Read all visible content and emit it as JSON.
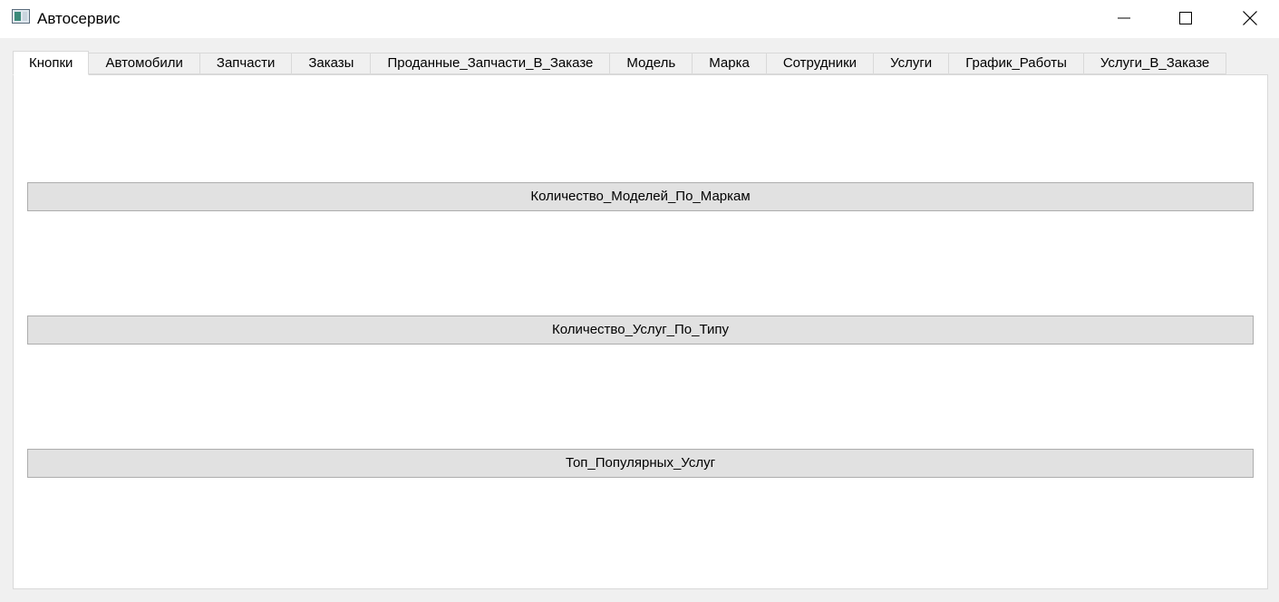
{
  "window": {
    "title": "Автосервис",
    "icon": "app-window-icon",
    "controls": {
      "minimize_icon": "minimize-icon",
      "maximize_icon": "maximize-icon",
      "close_icon": "close-icon"
    }
  },
  "tabs": [
    {
      "label": "Кнопки",
      "active": true
    },
    {
      "label": "Автомобили",
      "active": false
    },
    {
      "label": "Запчасти",
      "active": false
    },
    {
      "label": "Заказы",
      "active": false
    },
    {
      "label": "Проданные_Запчасти_В_Заказе",
      "active": false
    },
    {
      "label": "Модель",
      "active": false
    },
    {
      "label": "Марка",
      "active": false
    },
    {
      "label": "Сотрудники",
      "active": false
    },
    {
      "label": "Услуги",
      "active": false
    },
    {
      "label": "График_Работы",
      "active": false
    },
    {
      "label": "Услуги_В_Заказе",
      "active": false
    }
  ],
  "buttons_tab": {
    "buttons": [
      {
        "label": "Количество_Моделей_По_Маркам"
      },
      {
        "label": "Количество_Услуг_По_Типу"
      },
      {
        "label": "Топ_Популярных_Услуг"
      }
    ]
  },
  "colors": {
    "window_bg": "#f0f0f0",
    "panel_bg": "#ffffff",
    "button_bg": "#e1e1e1",
    "button_border": "#adadad",
    "tab_border": "#d9d9d9"
  }
}
